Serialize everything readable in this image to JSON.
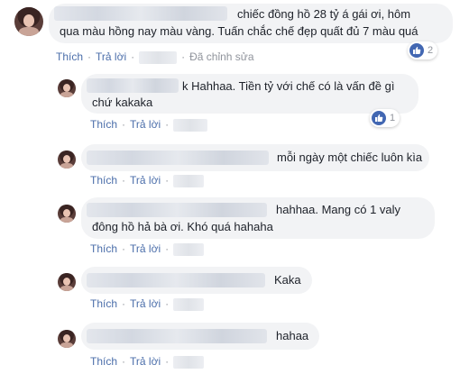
{
  "actions": {
    "like": "Thích",
    "reply": "Trả lời",
    "edited": "Đã chỉnh sửa",
    "separator": "·"
  },
  "comments": [
    {
      "line1": "chiếc đồng hồ 28 tỷ á gái ơi, hôm",
      "line2": "qua màu hồng nay màu vàng. Tuấn chắc chế đẹp quất đủ 7 màu quá",
      "reactions": "2",
      "reaction_icon": "like-icon"
    },
    {
      "line1": "k Hahhaa. Tiền tỷ với chế có là vấn đề gì",
      "line2": "chứ kakaka",
      "reactions": "1",
      "reaction_icon": "like-icon"
    },
    {
      "line1": "mỗi ngày một chiếc luôn kìa"
    },
    {
      "line1": "hahhaa. Mang có 1 valy",
      "line2": "đông hồ hả bà ơi. Khó quá hahaha"
    },
    {
      "line1": "Kaka"
    },
    {
      "line1": "hahaa"
    }
  ],
  "colors": {
    "bubble": "#f2f3f5",
    "link": "#4b6eaa",
    "muted": "#90949c",
    "like_blue": "#4267b2"
  }
}
